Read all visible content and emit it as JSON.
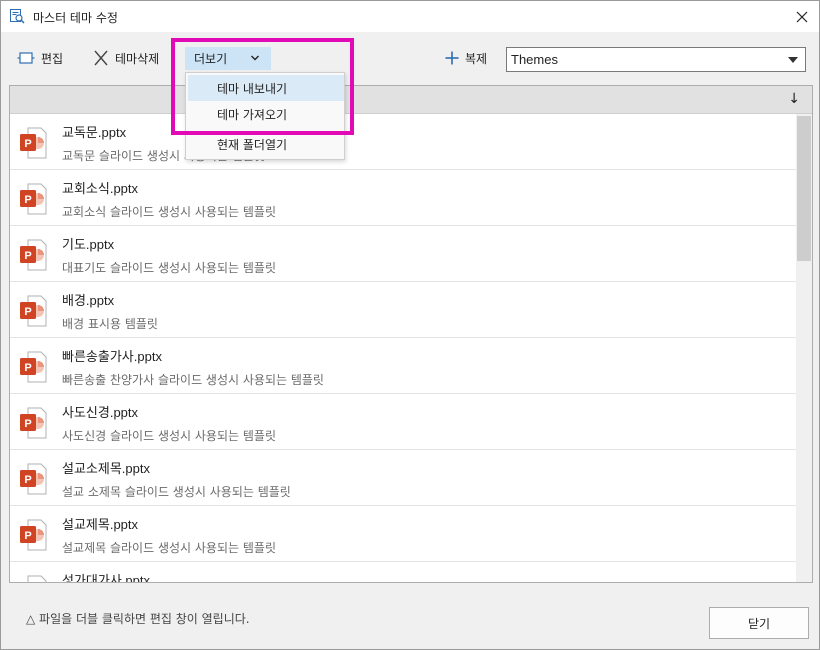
{
  "window": {
    "title": "마스터 테마 수정",
    "close_icon": "close-icon",
    "title_icon": "theme-search-icon"
  },
  "toolbar": {
    "edit_label": "편집",
    "delete_label": "테마삭제",
    "more_label": "더보기",
    "duplicate_label": "복제",
    "theme_select_value": "Themes"
  },
  "more_menu": {
    "items": [
      "테마 내보내기",
      "테마 가져오기",
      "현재 폴더열기"
    ],
    "highlighted_index": 0
  },
  "list": {
    "sort_icon": "↓",
    "rows": [
      {
        "name": "교독문.pptx",
        "desc": "교독문 슬라이드 생성시 사용되는 템플릿"
      },
      {
        "name": "교회소식.pptx",
        "desc": "교회소식 슬라이드 생성시 사용되는 템플릿"
      },
      {
        "name": "기도.pptx",
        "desc": "대표기도 슬라이드 생성시 사용되는 템플릿"
      },
      {
        "name": "배경.pptx",
        "desc": "배경 표시용 템플릿"
      },
      {
        "name": "빠른송출가사.pptx",
        "desc": "빠른송출 찬양가사 슬라이드 생성시 사용되는 템플릿"
      },
      {
        "name": "사도신경.pptx",
        "desc": "사도신경 슬라이드 생성시 사용되는 템플릿"
      },
      {
        "name": "설교소제목.pptx",
        "desc": "설교 소제목 슬라이드 생성시 사용되는 템플릿"
      },
      {
        "name": "설교제목.pptx",
        "desc": "설교제목 슬라이드 생성시 사용되는 템플릿"
      },
      {
        "name": "성가대가사.pptx",
        "desc": ""
      }
    ]
  },
  "footer": {
    "note": "△ 파일을 더블 클릭하면 편집 창이 열립니다.",
    "close_label": "닫기"
  },
  "colors": {
    "highlight_border": "#e20ab7",
    "more_button_bg": "#cde4f7",
    "ppt_orange": "#d04423"
  }
}
